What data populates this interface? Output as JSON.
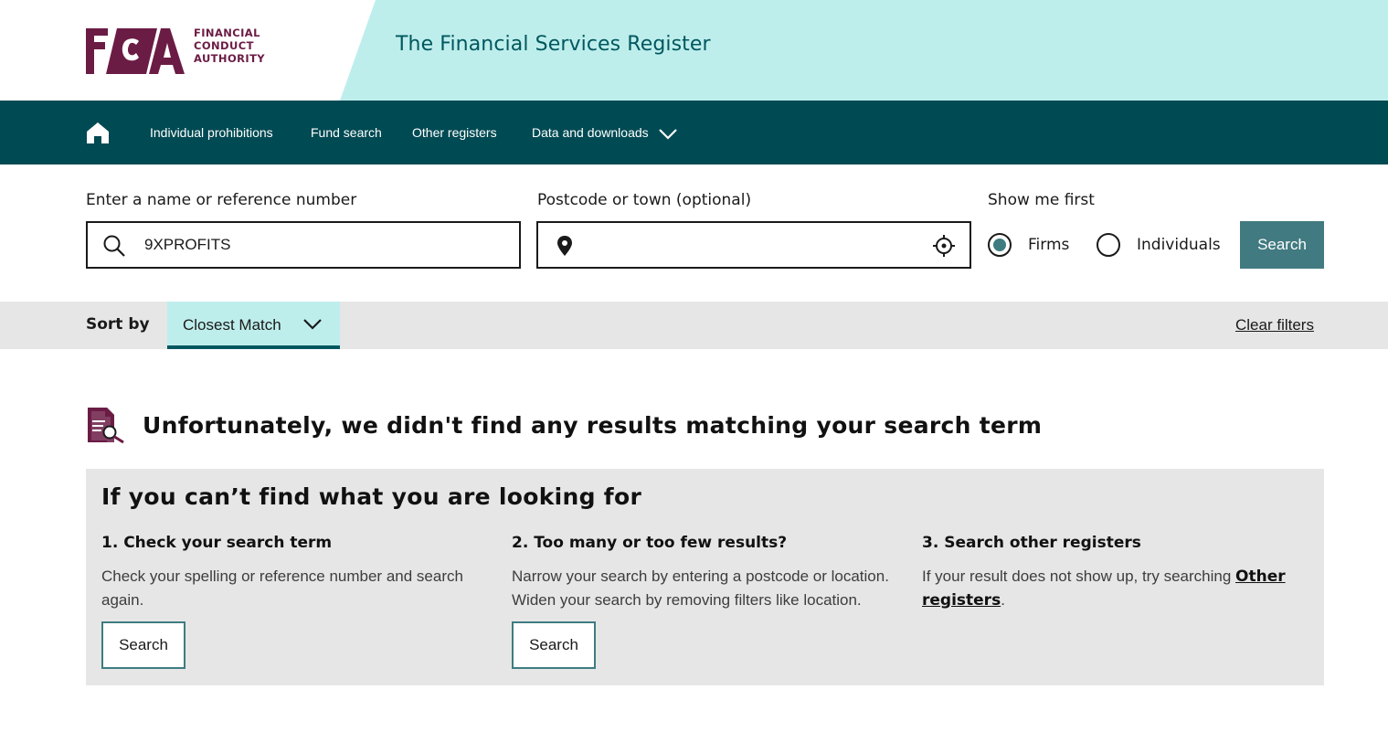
{
  "header": {
    "logo_letters": "FCA",
    "logo_words": [
      "FINANCIAL",
      "CONDUCT",
      "AUTHORITY"
    ],
    "title": "The Financial Services Register"
  },
  "nav": {
    "home_icon": "home-icon",
    "items": [
      {
        "label": "Individual prohibitions"
      },
      {
        "label": "Fund search"
      },
      {
        "label": "Other registers"
      },
      {
        "label": "Data and downloads"
      }
    ]
  },
  "search": {
    "name_label": "Enter a name or reference number",
    "name_value": "9XPROFITS",
    "location_label": "Postcode or town (optional)",
    "location_value": "",
    "show_me_first_label": "Show me first",
    "options": [
      {
        "label": "Firms",
        "checked": true
      },
      {
        "label": "Individuals",
        "checked": false
      }
    ],
    "button_label": "Search"
  },
  "sort": {
    "label": "Sort by",
    "selected": "Closest Match",
    "clear_filters": "Clear filters"
  },
  "no_results": {
    "heading": "Unfortunately, we didn't find any results matching your search term"
  },
  "help": {
    "title": "If you can’t find what you are looking for",
    "columns": [
      {
        "heading": "1. Check your search term",
        "text": "Check your spelling or reference number and search again.",
        "button": "Search"
      },
      {
        "heading": "2. Too many or too few results?",
        "text": "Narrow your search by entering a postcode or location. Widen your search by removing filters like location.",
        "button": "Search"
      },
      {
        "heading": "3. Search other registers",
        "text_before": "If your result does not show up, try searching ",
        "link": "Other registers",
        "text_after": "."
      }
    ]
  },
  "colors": {
    "brand": "#6b1c45",
    "nav_bg": "#004a53",
    "header_bg": "#beeeec",
    "accent": "#417a80"
  }
}
